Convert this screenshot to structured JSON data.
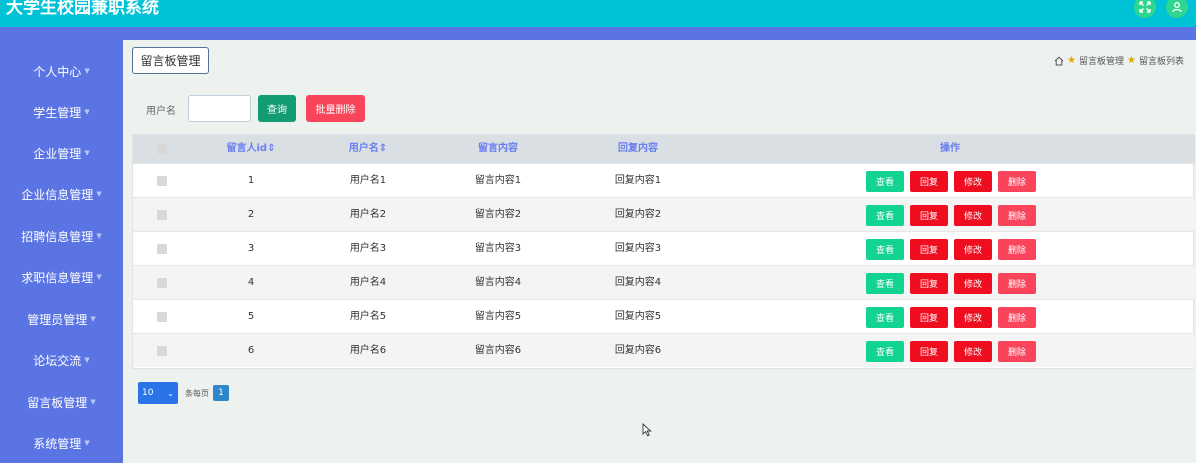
{
  "app": {
    "title": "大学生校园兼职系统"
  },
  "topbar": {
    "icons": [
      "fullscreen-icon",
      "user-icon"
    ]
  },
  "sidebar": {
    "items": [
      {
        "label": "个人中心"
      },
      {
        "label": "学生管理"
      },
      {
        "label": "企业管理"
      },
      {
        "label": "企业信息管理"
      },
      {
        "label": "招聘信息管理"
      },
      {
        "label": "求职信息管理"
      },
      {
        "label": "管理员管理"
      },
      {
        "label": "论坛交流"
      },
      {
        "label": "留言板管理"
      },
      {
        "label": "系统管理"
      }
    ]
  },
  "header": {
    "section_button": "留言板管理",
    "breadcrumb": [
      "留言板管理",
      "留言板列表"
    ]
  },
  "search": {
    "label": "用户名",
    "value": "",
    "query_label": "查询",
    "batch_delete_label": "批量删除"
  },
  "table": {
    "columns": [
      "留言人id",
      "用户名",
      "留言内容",
      "回复内容",
      "操作"
    ],
    "sortable": [
      "留言人id",
      "用户名"
    ],
    "rows": [
      {
        "id": "1",
        "username": "用户名1",
        "content": "留言内容1",
        "reply": "回复内容1"
      },
      {
        "id": "2",
        "username": "用户名2",
        "content": "留言内容2",
        "reply": "回复内容2"
      },
      {
        "id": "3",
        "username": "用户名3",
        "content": "留言内容3",
        "reply": "回复内容3"
      },
      {
        "id": "4",
        "username": "用户名4",
        "content": "留言内容4",
        "reply": "回复内容4"
      },
      {
        "id": "5",
        "username": "用户名5",
        "content": "留言内容5",
        "reply": "回复内容5"
      },
      {
        "id": "6",
        "username": "用户名6",
        "content": "留言内容6",
        "reply": "回复内容6"
      }
    ],
    "actions": {
      "view": "查看",
      "reply": "回复",
      "edit": "修改",
      "delete": "删除"
    }
  },
  "pagination": {
    "page_size": "10",
    "per_page_label": "条每页",
    "current_page": "1"
  },
  "colors": {
    "topbar": "#00c2d6",
    "sidebar": "#5a74e4",
    "view": "#13d390",
    "reply": "#ef0e20",
    "edit": "#ef0e20",
    "delete": "#f9445c",
    "query": "#139c73",
    "batch_delete": "#f9455a"
  }
}
